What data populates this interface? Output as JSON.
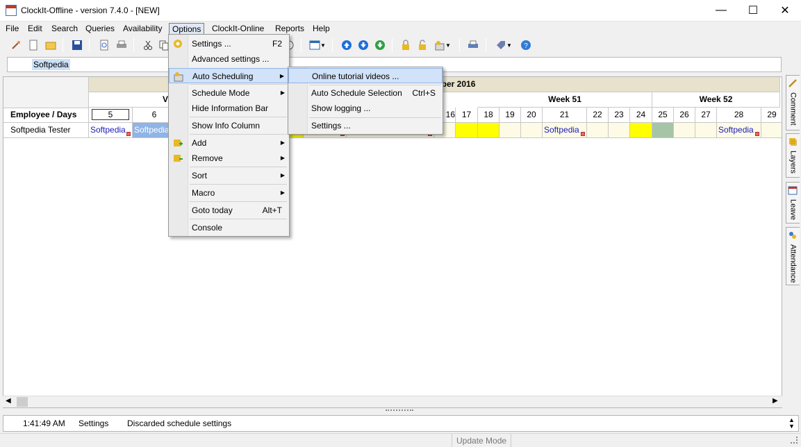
{
  "window": {
    "title": "ClockIt-Offline - version  7.4.0 - [NEW]",
    "minimize": "—",
    "maximize": "☐",
    "close": "✕"
  },
  "menubar": [
    "File",
    "Edit",
    "Search",
    "Queries",
    "Availability",
    "Options",
    "ClockIt-Online",
    "Reports",
    "Help"
  ],
  "filter": {
    "chip": "Softpedia"
  },
  "grid": {
    "corner_label": "Employee / Days",
    "month_label": "mber 2016",
    "weeks": [
      {
        "label": "Week 51"
      },
      {
        "label": "Week 52"
      }
    ],
    "week_partial": "V",
    "day_numbers": [
      "5",
      "6",
      "16",
      "17",
      "18",
      "19",
      "20",
      "21",
      "22",
      "23",
      "24",
      "25",
      "26",
      "27",
      "28",
      "29"
    ],
    "employee": "Softpedia Tester",
    "entries": {
      "d5": "Softpedia",
      "d6": "Softpedia",
      "d21": "Softpedia",
      "d28": "Softpedia"
    }
  },
  "options_menu": {
    "items": [
      {
        "label": "Settings ...",
        "shortcut": "F2"
      },
      {
        "label": "Advanced settings ...",
        "shortcut": ""
      },
      {
        "label": "Auto Scheduling",
        "shortcut": ""
      },
      {
        "label": "Schedule Mode",
        "shortcut": ""
      },
      {
        "label": "Hide Information Bar",
        "shortcut": ""
      },
      {
        "label": "Show Info Column",
        "shortcut": ""
      },
      {
        "label": "Add",
        "shortcut": ""
      },
      {
        "label": "Remove",
        "shortcut": ""
      },
      {
        "label": "Sort",
        "shortcut": ""
      },
      {
        "label": "Macro",
        "shortcut": ""
      },
      {
        "label": "Goto today",
        "shortcut": "Alt+T"
      },
      {
        "label": "Console",
        "shortcut": ""
      }
    ]
  },
  "auto_sched_menu": {
    "items": [
      {
        "label": "Online tutorial videos ...",
        "shortcut": ""
      },
      {
        "label": "Auto Schedule Selection",
        "shortcut": "Ctrl+S"
      },
      {
        "label": "Show logging ...",
        "shortcut": ""
      },
      {
        "label": "Settings ...",
        "shortcut": ""
      }
    ]
  },
  "side_tabs": [
    "Comment",
    "Layers",
    "Leave",
    "Attendance"
  ],
  "log": {
    "time": "1:41:49 AM",
    "source": "Settings",
    "message": "Discarded schedule settings"
  },
  "status": {
    "mode": "Update Mode"
  },
  "colors": {
    "accent": "#d2e2f8",
    "highlight_day": "#ffff00",
    "weekend": "#a6c4a6"
  }
}
